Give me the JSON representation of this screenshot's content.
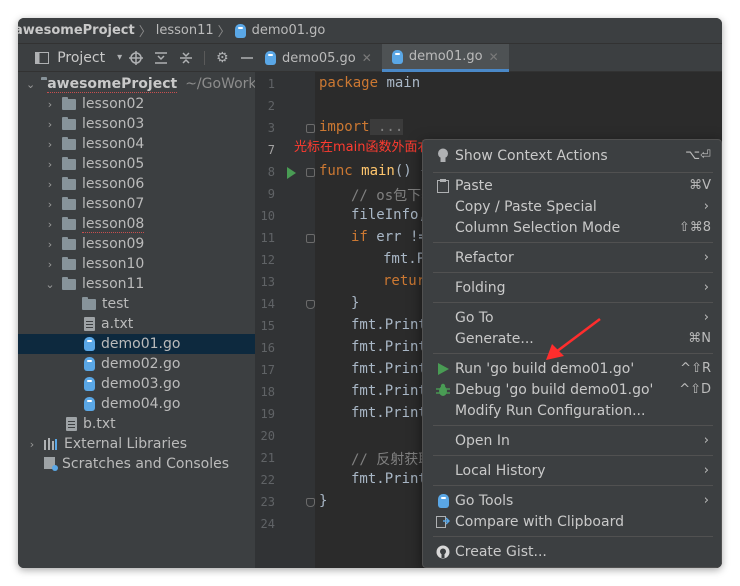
{
  "breadcrumb": {
    "project": "awesomeProject",
    "folder": "lesson11",
    "file": "demo01.go"
  },
  "project_panel": {
    "title": "Project"
  },
  "tabs": [
    {
      "label": "demo05.go",
      "active": false
    },
    {
      "label": "demo01.go",
      "active": true
    }
  ],
  "tree": {
    "root": {
      "label": "awesomeProject",
      "path": "~/GoWorks"
    },
    "folders": [
      "lesson02",
      "lesson03",
      "lesson04",
      "lesson05",
      "lesson06",
      "lesson07",
      "lesson08",
      "lesson09",
      "lesson10",
      "lesson11"
    ],
    "lesson11_children": {
      "folder": "test",
      "files": [
        "a.txt",
        "demo01.go",
        "demo02.go",
        "demo03.go",
        "demo04.go"
      ]
    },
    "root_file": "b.txt",
    "external": "External Libraries",
    "scratches": "Scratches and Consoles"
  },
  "editor": {
    "line_numbers": [
      "1",
      "2",
      "3",
      "7",
      "8",
      "9",
      "10",
      "11",
      "12",
      "13",
      "14",
      "15",
      "16",
      "17",
      "18",
      "19",
      "20",
      "21",
      "22",
      "23",
      "24"
    ],
    "lines": {
      "l1_kw": "package",
      "l1_name": " main",
      "l3_kw": "import",
      "l3_rest": " ...",
      "l8_kw": "func",
      "l8_fn": " main",
      "l8_rest": "() {",
      "l9": "// os包下获",
      "l10": "fileInfo,",
      "l11_kw": "if",
      "l11_rest": " err !=",
      "l12": "fmt.P",
      "l13": "retur",
      "l14": "}",
      "l15": "fmt.Print",
      "l16": "fmt.Print",
      "l17": "fmt.Print",
      "l18": "fmt.Print",
      "l19": "fmt.Print",
      "l21": "// 反射获取",
      "l22": "fmt.Print",
      "l23": "}"
    },
    "annotation": "光标在main函数外面右键"
  },
  "context_menu": {
    "items": {
      "show_context_actions": {
        "label": "Show Context Actions",
        "shortcut": "⌥⏎"
      },
      "paste": {
        "label": "Paste",
        "shortcut": "⌘V"
      },
      "copy_paste_special": {
        "label": "Copy / Paste Special"
      },
      "column_selection_mode": {
        "label": "Column Selection Mode",
        "shortcut": "⇧⌘8"
      },
      "refactor": {
        "label": "Refactor"
      },
      "folding": {
        "label": "Folding"
      },
      "go_to": {
        "label": "Go To"
      },
      "generate": {
        "label": "Generate...",
        "shortcut": "⌘N"
      },
      "run": {
        "label": "Run 'go build demo01.go'",
        "shortcut": "^⇧R"
      },
      "debug": {
        "label": "Debug 'go build demo01.go'",
        "shortcut": "^⇧D"
      },
      "modify_run_config": {
        "label": "Modify Run Configuration..."
      },
      "open_in": {
        "label": "Open In"
      },
      "local_history": {
        "label": "Local History"
      },
      "go_tools": {
        "label": "Go Tools"
      },
      "compare_clipboard": {
        "label": "Compare with Clipboard"
      },
      "create_gist": {
        "label": "Create Gist..."
      }
    }
  },
  "colors": {
    "annotation": "#ff3b30",
    "run_green": "#499c54",
    "selection": "#0d293e"
  }
}
